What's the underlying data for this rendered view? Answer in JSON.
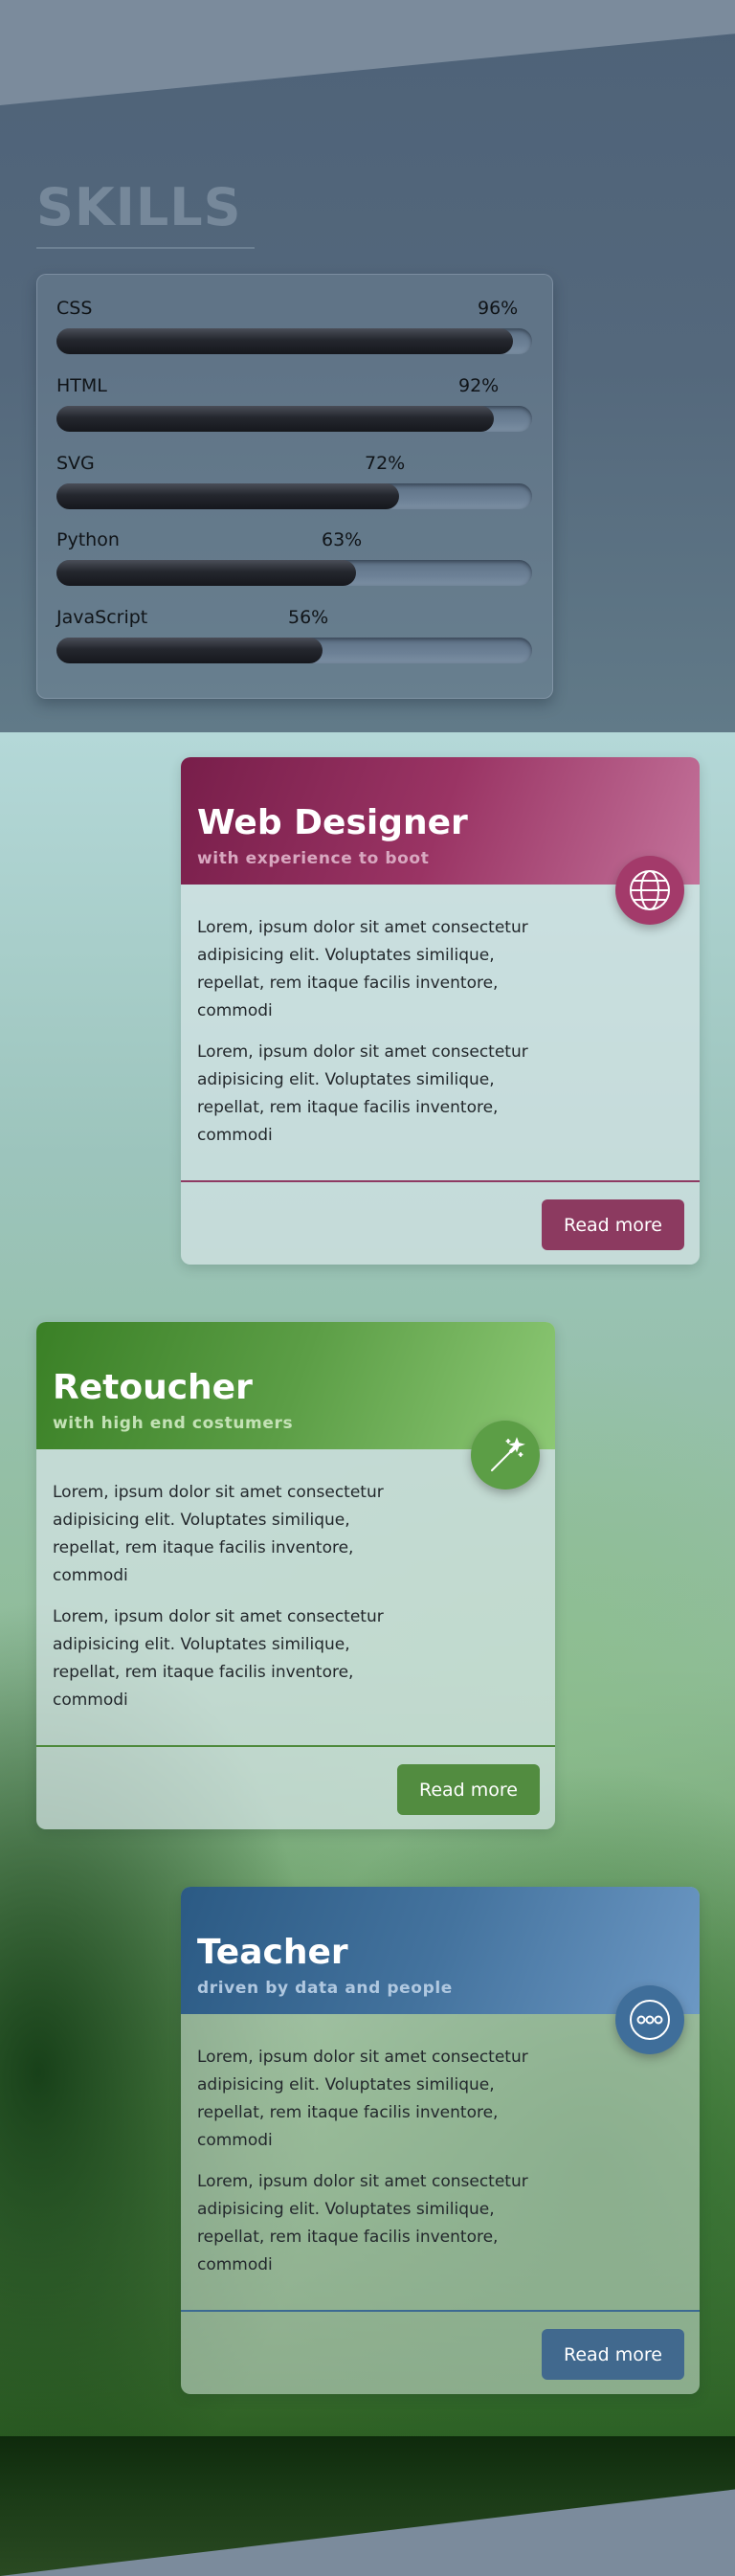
{
  "skills": {
    "title": "SKILLS",
    "items": [
      {
        "name": "CSS",
        "percent_label": "96%",
        "level": 0.96
      },
      {
        "name": "HTML",
        "percent_label": "92%",
        "level": 0.92
      },
      {
        "name": "SVG",
        "percent_label": "72%",
        "level": 0.72
      },
      {
        "name": "Python",
        "percent_label": "63%",
        "level": 0.63
      },
      {
        "name": "JavaScript",
        "percent_label": "56%",
        "level": 0.56
      }
    ]
  },
  "cards": [
    {
      "title": "Web Designer",
      "subtitle": "with experience to boot",
      "icon": "globe-icon",
      "accent": "#9a3464",
      "paragraphs": [
        "Lorem, ipsum dolor sit amet consectetur adipisicing elit. Voluptates similique, repellat, rem itaque facilis inventore, commodi",
        "Lorem, ipsum dolor sit amet consectetur adipisicing elit. Voluptates similique, repellat, rem itaque facilis inventore, commodi"
      ],
      "button_label": "Read more"
    },
    {
      "title": "Retoucher",
      "subtitle": "with high end costumers",
      "icon": "magic-wand-icon",
      "accent": "#5c9e46",
      "paragraphs": [
        "Lorem, ipsum dolor sit amet consectetur adipisicing elit. Voluptates similique, repellat, rem itaque facilis inventore, commodi",
        "Lorem, ipsum dolor sit amet consectetur adipisicing elit. Voluptates similique, repellat, rem itaque facilis inventore, commodi"
      ],
      "button_label": "Read more"
    },
    {
      "title": "Teacher",
      "subtitle": "driven by data and people",
      "icon": "more-dots-icon",
      "accent": "#44739e",
      "paragraphs": [
        "Lorem, ipsum dolor sit amet consectetur adipisicing elit. Voluptates similique, repellat, rem itaque facilis inventore, commodi",
        "Lorem, ipsum dolor sit amet consectetur adipisicing elit. Voluptates similique, repellat, rem itaque facilis inventore, commodi"
      ],
      "button_label": "Read more"
    }
  ]
}
